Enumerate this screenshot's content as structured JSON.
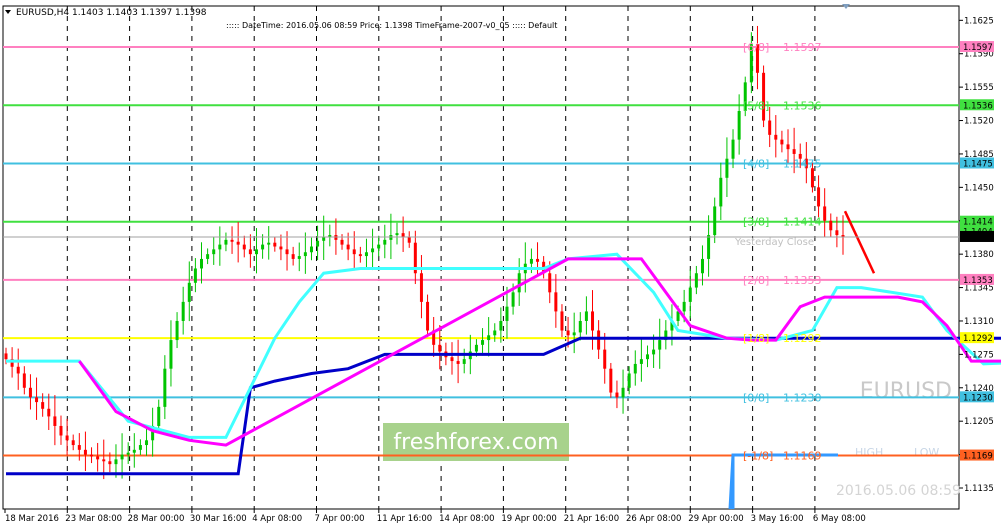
{
  "header": {
    "title": "EURUSD,H4  1.1403 1.1403 1.1397 1.1398",
    "info": "::::: DateTime: 2016.05.06 08:59    Price: 1.1398    TimeFrame-2007-v0_05    ::::: Default"
  },
  "watermark": {
    "symbol": "EURUSD",
    "brand": "freshforex.com",
    "timestamp": "2016.05.06 08:59",
    "high_label": "HIGH",
    "low_label": "LOW",
    "close_label": "Yesterday Close"
  },
  "colors": {
    "bull": "#00c400",
    "bear": "#ff0000",
    "blue_line": "#0000c8",
    "cyan_line": "#40ffff",
    "magenta_line": "#ff00ff",
    "projection": "#ff0000",
    "current_price": "#a0a0a0"
  },
  "chart_data": {
    "type": "candlestick",
    "symbol": "EURUSD",
    "timeframe": "H4",
    "ylim": [
      1.1113,
      1.164
    ],
    "y_ticks": [
      "1.1625",
      "1.1590",
      "1.1555",
      "1.1520",
      "1.1485",
      "1.1450",
      "1.1415",
      "1.1380",
      "1.1345",
      "1.1310",
      "1.1275",
      "1.1240",
      "1.1205",
      "1.1170",
      "1.1135"
    ],
    "x_ticks": [
      "18 Mar 2016",
      "23 Mar 08:00",
      "28 Mar 00:00",
      "30 Mar 16:00",
      "4 Apr 08:00",
      "7 Apr 00:00",
      "11 Apr 16:00",
      "14 Apr 08:00",
      "19 Apr 00:00",
      "21 Apr 16:00",
      "26 Apr 08:00",
      "29 Apr 00:00",
      "3 May 16:00",
      "6 May 08:00"
    ],
    "current_price": 1.1398,
    "murrey_levels": [
      {
        "label": "[6/8]",
        "value": 1.1597,
        "price": "1.1597",
        "color": "#ff80c0"
      },
      {
        "label": "[5/8]",
        "value": 1.1536,
        "price": "1.1536",
        "color": "#40e040"
      },
      {
        "label": "[4/8]",
        "value": 1.1475,
        "price": "1.1475",
        "color": "#40c0e0"
      },
      {
        "label": "[3/8]",
        "value": 1.1414,
        "price": "1.1414",
        "color": "#40e040"
      },
      {
        "label": "[2/8]",
        "value": 1.1353,
        "price": "1.1353",
        "color": "#ff80c0"
      },
      {
        "label": "[1/8]",
        "value": 1.1292,
        "price": "1.1292",
        "color": "#ffff00"
      },
      {
        "label": "[0/8]",
        "value": 1.123,
        "price": "1.1230",
        "color": "#40c0e0"
      },
      {
        "label": "[-1/8]",
        "value": 1.1169,
        "price": "1.1169",
        "color": "#ff6020"
      }
    ],
    "extra_axis_labels": [
      {
        "price": "1.1404",
        "value": 1.1404,
        "color": "#40e040"
      },
      {
        "price": "1.1398",
        "value": 1.1398,
        "color": "#000000"
      }
    ],
    "ohlc_path": [
      1.127,
      1.1262,
      1.1255,
      1.124,
      1.123,
      1.1225,
      1.1218,
      1.121,
      1.12,
      1.119,
      1.1185,
      1.118,
      1.1175,
      1.117,
      1.1168,
      1.1165,
      1.1163,
      1.116,
      1.1165,
      1.117,
      1.1172,
      1.1175,
      1.118,
      1.1185,
      1.12,
      1.122,
      1.126,
      1.129,
      1.131,
      1.133,
      1.135,
      1.1365,
      1.1375,
      1.138,
      1.1385,
      1.139,
      1.1395,
      1.1393,
      1.139,
      1.1385,
      1.138,
      1.1385,
      1.139,
      1.1392,
      1.1388,
      1.1385,
      1.138,
      1.1375,
      1.1378,
      1.1382,
      1.1388,
      1.1394,
      1.1398,
      1.14,
      1.1395,
      1.139,
      1.1385,
      1.138,
      1.1378,
      1.1382,
      1.1386,
      1.139,
      1.1395,
      1.14,
      1.1402,
      1.1398,
      1.1392,
      1.136,
      1.133,
      1.13,
      1.1285,
      1.1278,
      1.1272,
      1.1268,
      1.1265,
      1.127,
      1.1278,
      1.1285,
      1.129,
      1.1295,
      1.13,
      1.131,
      1.1325,
      1.134,
      1.136,
      1.137,
      1.1375,
      1.1372,
      1.136,
      1.134,
      1.132,
      1.13,
      1.1295,
      1.1298,
      1.131,
      1.132,
      1.13,
      1.128,
      1.126,
      1.1235,
      1.123,
      1.124,
      1.1255,
      1.1265,
      1.127,
      1.1275,
      1.128,
      1.129,
      1.13,
      1.131,
      1.132,
      1.133,
      1.1345,
      1.136,
      1.1375,
      1.14,
      1.143,
      1.146,
      1.148,
      1.15,
      1.153,
      1.156,
      1.16,
      1.157,
      1.152,
      1.1505,
      1.15,
      1.1495,
      1.149,
      1.1485,
      1.148,
      1.147,
      1.145,
      1.143,
      1.1415,
      1.1405,
      1.14,
      1.1398
    ],
    "blue_line": [
      [
        0,
        1.115
      ],
      [
        38,
        1.115
      ],
      [
        40,
        1.124
      ],
      [
        44,
        1.1247
      ],
      [
        50,
        1.1255
      ],
      [
        56,
        1.126
      ],
      [
        62,
        1.1275
      ],
      [
        88,
        1.1275
      ],
      [
        94,
        1.1292
      ],
      [
        186,
        1.1292
      ],
      [
        188,
        1.1355
      ],
      [
        190,
        1.1372
      ],
      [
        194,
        1.1388
      ],
      [
        197,
        1.1398
      ]
    ],
    "cyan_line": [
      [
        0,
        1.1268
      ],
      [
        12,
        1.1268
      ],
      [
        20,
        1.1205
      ],
      [
        30,
        1.1188
      ],
      [
        36,
        1.1188
      ],
      [
        40,
        1.124
      ],
      [
        44,
        1.1292
      ],
      [
        48,
        1.133
      ],
      [
        52,
        1.136
      ],
      [
        58,
        1.1365
      ],
      [
        88,
        1.1365
      ],
      [
        92,
        1.1375
      ],
      [
        100,
        1.138
      ],
      [
        106,
        1.134
      ],
      [
        110,
        1.13
      ],
      [
        118,
        1.1292
      ],
      [
        126,
        1.129
      ],
      [
        132,
        1.13
      ],
      [
        136,
        1.1345
      ],
      [
        140,
        1.1345
      ],
      [
        150,
        1.1335
      ],
      [
        154,
        1.13
      ],
      [
        160,
        1.1265
      ],
      [
        170,
        1.1268
      ],
      [
        178,
        1.129
      ],
      [
        182,
        1.133
      ],
      [
        186,
        1.139
      ],
      [
        190,
        1.145
      ],
      [
        194,
        1.149
      ],
      [
        198,
        1.1505
      ],
      [
        205,
        1.1505
      ]
    ],
    "magenta_line": [
      [
        12,
        1.1268
      ],
      [
        18,
        1.1215
      ],
      [
        24,
        1.1195
      ],
      [
        30,
        1.1185
      ],
      [
        36,
        1.118
      ],
      [
        92,
        1.1375
      ],
      [
        104,
        1.1375
      ],
      [
        108,
        1.134
      ],
      [
        112,
        1.1305
      ],
      [
        118,
        1.1292
      ],
      [
        122,
        1.129
      ],
      [
        126,
        1.129
      ],
      [
        130,
        1.1325
      ],
      [
        134,
        1.1335
      ],
      [
        146,
        1.1335
      ],
      [
        150,
        1.133
      ],
      [
        154,
        1.1305
      ],
      [
        158,
        1.1268
      ],
      [
        170,
        1.1268
      ],
      [
        205,
        1.1505
      ],
      [
        210,
        1.147
      ],
      [
        212,
        1.144
      ],
      [
        216,
        1.143
      ]
    ],
    "projection": [
      [
        1.1425,
        1.136
      ]
    ]
  }
}
